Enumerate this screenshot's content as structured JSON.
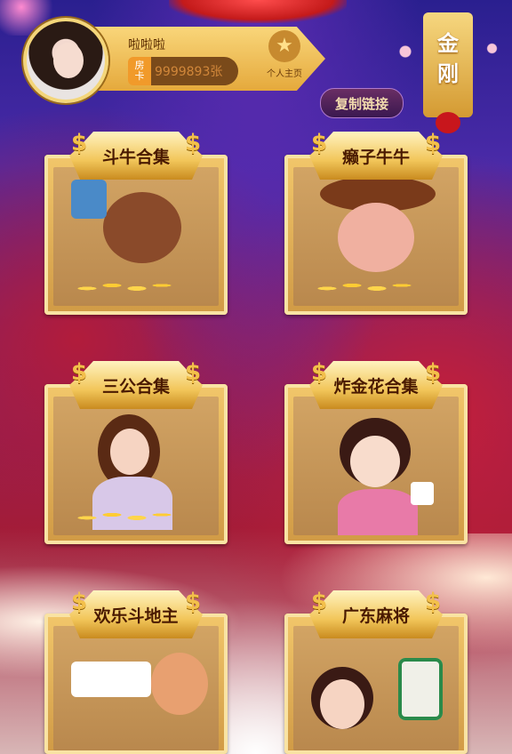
{
  "player": {
    "name": "啦啦啦",
    "room_card_tag_line1": "房",
    "room_card_tag_line2": "卡",
    "room_card_count": "9999893张",
    "profile_label": "个人主页"
  },
  "actions": {
    "copy_link_label": "复制链接"
  },
  "tier": {
    "line1": "金",
    "line2": "刚"
  },
  "games": [
    {
      "title": "斗牛合集",
      "icon": "bull-mascot-icon"
    },
    {
      "title": "癞子牛牛",
      "icon": "cowboy-cat-icon"
    },
    {
      "title": "三公合集",
      "icon": "lady-with-cards-icon"
    },
    {
      "title": "炸金花合集",
      "icon": "girl-with-dice-icon"
    },
    {
      "title": "欢乐斗地主",
      "icon": "landlord-cards-icon"
    },
    {
      "title": "广东麻将",
      "icon": "mahjong-tile-icon"
    }
  ],
  "colors": {
    "gold": "#f2c76b",
    "brown": "#4a1a00",
    "purple": "#4a2aa8",
    "red": "#a01c38"
  }
}
